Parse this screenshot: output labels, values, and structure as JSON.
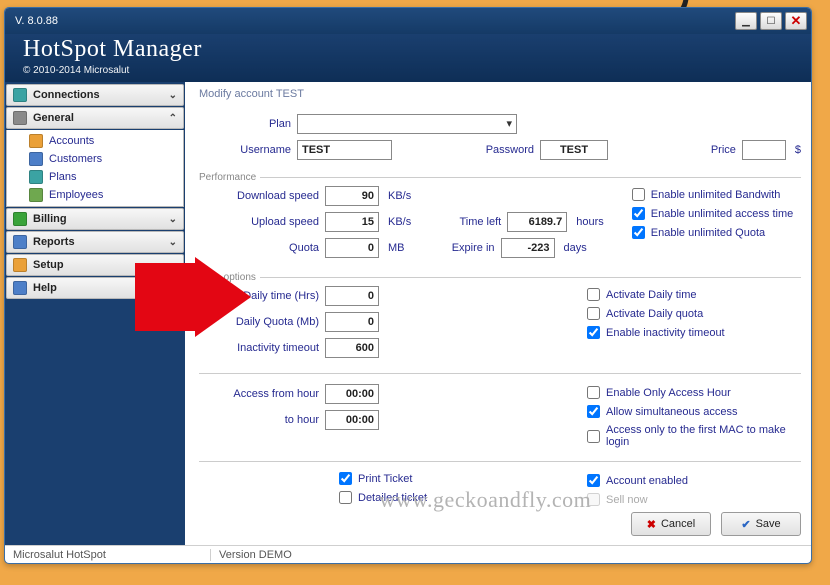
{
  "title_version": "V.  8.0.88",
  "app_title": "HotSpot Manager",
  "copyright": "© 2010-2014 Microsalut",
  "sidebar": {
    "sections": [
      {
        "label": "Connections",
        "chev": "¥",
        "open": false
      },
      {
        "label": "General",
        "chev": "^",
        "open": true,
        "items": [
          "Accounts",
          "Customers",
          "Plans",
          "Employees"
        ]
      },
      {
        "label": "Billing",
        "chev": "¥",
        "open": false
      },
      {
        "label": "Reports",
        "chev": "¥",
        "open": false
      },
      {
        "label": "Setup",
        "chev": "¥",
        "open": false
      },
      {
        "label": "Help",
        "chev": "",
        "open": false
      }
    ]
  },
  "crumb": "Modify account  TEST",
  "labels": {
    "plan": "Plan",
    "username": "Username",
    "password": "Password",
    "price": "Price",
    "currency": "$",
    "perf_legend": "Performance",
    "time_legend": "Time options",
    "dl": "Download speed",
    "ul": "Upload speed",
    "quota": "Quota",
    "kbs": "KB/s",
    "mb": "MB",
    "time_left": "Time left",
    "hours": "hours",
    "expire_in": "Expire in",
    "days": "days",
    "daily_time": "Daily time (Hrs)",
    "daily_quota": "Daily Quota (Mb)",
    "inactivity": "Inactivity timeout",
    "access_from": "Access from hour",
    "to_hour": "to hour"
  },
  "values": {
    "username": "TEST",
    "password": "TEST",
    "price": "",
    "plan": "",
    "dl": "90",
    "ul": "15",
    "quota": "0",
    "time_left": "6189.7",
    "expire_in": "-223",
    "daily_time": "0",
    "daily_quota": "0",
    "inactivity": "600",
    "from_hour": "00:00",
    "to_hour": "00:00"
  },
  "opts": {
    "bw": "Enable unlimited Bandwith",
    "time": "Enable unlimited access time",
    "quota": "Enable unlimited Quota",
    "daily_time": "Activate Daily time",
    "daily_quota": "Activate Daily quota",
    "inactivity": "Enable inactivity timeout",
    "only_hours": "Enable Only Access Hour",
    "simul": "Allow simultaneous access",
    "mac_only": "Access only to the first MAC to make login",
    "print_ticket": "Print Ticket",
    "detailed": "Detailed ticket",
    "enabled": "Account enabled",
    "sell": "Sell now"
  },
  "checked": {
    "bw": false,
    "time": true,
    "quota": true,
    "daily_time": false,
    "daily_quota": false,
    "inactivity": true,
    "only_hours": false,
    "simul": true,
    "mac_only": false,
    "print_ticket": true,
    "detailed": false,
    "enabled": true,
    "sell": false
  },
  "buttons": {
    "cancel": "Cancel",
    "save": "Save"
  },
  "status": {
    "left": "Microsalut HotSpot",
    "right": "Version DEMO"
  },
  "watermark": "www.geckoandfly.com"
}
